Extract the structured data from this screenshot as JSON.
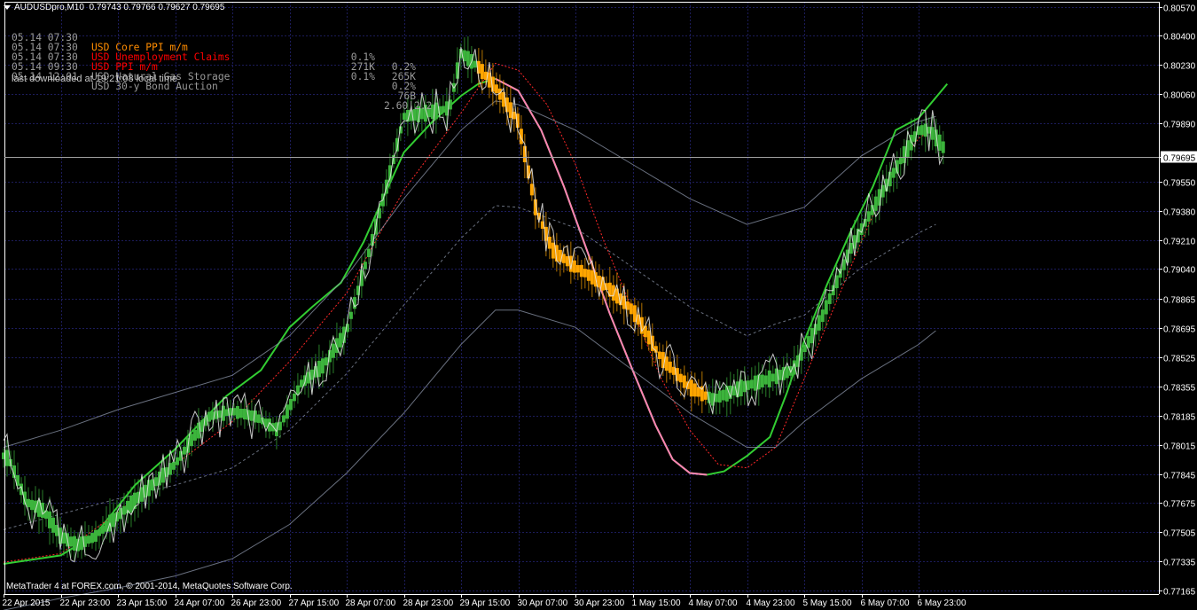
{
  "header": {
    "symbol": "AUDUSDpro,M10",
    "ohlc": "0.79743 0.79766 0.79627 0.79695"
  },
  "news": [
    {
      "time": "05.14 07:30",
      "currency": "USD",
      "event": "Core PPI m/m",
      "actual": "0.1%",
      "forecast": "0.2%",
      "color": "#ff8c00"
    },
    {
      "time": "05.14 07:30",
      "currency": "USD",
      "event": "Unemployment Claims",
      "actual": "271K",
      "forecast": "265K",
      "color": "#ff0000"
    },
    {
      "time": "05.14 07:30",
      "currency": "USD",
      "event": "PPI m/m",
      "actual": "0.1%",
      "forecast": "0.2%",
      "color": "#ff0000"
    },
    {
      "time": "05.14 09:30",
      "currency": "USD",
      "event": "Natural Gas Storage",
      "actual": "",
      "forecast": "76B",
      "color": "#9a9a9a"
    },
    {
      "time": "05.14 12:01",
      "currency": "USD",
      "event": "30-y Bond Auction",
      "actual": "",
      "forecast": "2.60|2.2",
      "color": "#9a9a9a"
    }
  ],
  "download_note": "last downloaded at 19:21:08 local time",
  "copyright": "MetaTrader 4 at FOREX.com, © 2001-2014, MetaQuotes Software Corp.",
  "colors": {
    "background": "#000000",
    "grid": "#1c1c5a",
    "axis": "#ffffff",
    "bull": "#3cb43c",
    "bear": "#ffa500",
    "close_line": "#e6e6e6",
    "ma_green": "#32cd32",
    "ma_pink": "#ff82b4",
    "ma_red_dotted": "#ff2828",
    "band_gray": "#8c96aa",
    "bid_line": "#a0a0a0"
  },
  "chart_data": {
    "type": "line",
    "title": "AUDUSDpro,M10",
    "ylim": [
      0.77165,
      0.80578
    ],
    "current_price": 0.79695,
    "y_ticks": [
      "0.80570",
      "0.80400",
      "0.80230",
      "0.80060",
      "0.79890",
      "0.79695",
      "0.79550",
      "0.79380",
      "0.79210",
      "0.79040",
      "0.78865",
      "0.78695",
      "0.78525",
      "0.78355",
      "0.78185",
      "0.78015",
      "0.77845",
      "0.77675",
      "0.77505",
      "0.77335",
      "0.77165"
    ],
    "x_ticks": [
      "22 Apr 2015",
      "22 Apr 23:00",
      "23 Apr 15:00",
      "24 Apr 07:00",
      "26 Apr 23:00",
      "27 Apr 15:00",
      "28 Apr 07:00",
      "28 Apr 23:00",
      "29 Apr 15:00",
      "30 Apr 07:00",
      "30 Apr 23:00",
      "1 May 15:00",
      "4 May 07:00",
      "4 May 23:00",
      "5 May 15:00",
      "6 May 07:00",
      "6 May 23:00"
    ],
    "x_positions": [
      0,
      1,
      2,
      3,
      4,
      5,
      6,
      7,
      8,
      9,
      10,
      11,
      12,
      13,
      14,
      15,
      16
    ],
    "price_path": [
      [
        0.0,
        0.7795
      ],
      [
        0.1,
        0.7793
      ],
      [
        0.4,
        0.7768
      ],
      [
        0.7,
        0.7763
      ],
      [
        1.0,
        0.7748
      ],
      [
        1.3,
        0.7743
      ],
      [
        1.6,
        0.7748
      ],
      [
        2.0,
        0.776
      ],
      [
        2.5,
        0.7775
      ],
      [
        3.0,
        0.779
      ],
      [
        3.3,
        0.7805
      ],
      [
        3.6,
        0.7818
      ],
      [
        4.0,
        0.7821
      ],
      [
        4.4,
        0.7818
      ],
      [
        4.7,
        0.7812
      ],
      [
        4.8,
        0.781
      ],
      [
        5.2,
        0.7837
      ],
      [
        5.6,
        0.7848
      ],
      [
        6.0,
        0.7868
      ],
      [
        6.4,
        0.7915
      ],
      [
        6.8,
        0.7965
      ],
      [
        7.0,
        0.7993
      ],
      [
        7.4,
        0.7995
      ],
      [
        7.8,
        0.7998
      ],
      [
        8.0,
        0.803
      ],
      [
        8.3,
        0.8022
      ],
      [
        8.6,
        0.801
      ],
      [
        9.0,
        0.799
      ],
      [
        9.3,
        0.794
      ],
      [
        9.6,
        0.7915
      ],
      [
        10.0,
        0.7905
      ],
      [
        10.5,
        0.7895
      ],
      [
        11.0,
        0.788
      ],
      [
        11.5,
        0.7852
      ],
      [
        12.0,
        0.7835
      ],
      [
        12.4,
        0.7828
      ],
      [
        13.0,
        0.7836
      ],
      [
        13.4,
        0.784
      ],
      [
        13.8,
        0.7845
      ],
      [
        14.3,
        0.7875
      ],
      [
        14.8,
        0.7915
      ],
      [
        15.3,
        0.7945
      ],
      [
        15.7,
        0.7968
      ],
      [
        16.0,
        0.7985
      ],
      [
        16.2,
        0.7985
      ],
      [
        16.5,
        0.7972
      ],
      [
        16.5,
        0.79695
      ]
    ],
    "bear_segment": [
      8.3,
      12.3
    ],
    "series": [
      {
        "name": "",
        "color": "#32cd32",
        "style": "solid",
        "values": [
          [
            0.0,
            0.7732
          ],
          [
            1.0,
            0.7737
          ],
          [
            1.6,
            0.7749
          ],
          [
            2.3,
            0.7778
          ],
          [
            3.0,
            0.7799
          ],
          [
            3.9,
            0.783
          ],
          [
            4.5,
            0.7845
          ],
          [
            5.0,
            0.787
          ],
          [
            5.4,
            0.7882
          ],
          [
            5.9,
            0.7896
          ],
          [
            6.3,
            0.792
          ],
          [
            6.7,
            0.795
          ],
          [
            7.0,
            0.7972
          ],
          [
            7.5,
            0.799
          ],
          [
            8.0,
            0.8005
          ],
          [
            8.3,
            0.8012
          ],
          [
            8.6,
            0.8015
          ],
          [
            9.0,
            0.8008
          ],
          [
            9.4,
            0.7985
          ],
          [
            9.8,
            0.7952
          ],
          [
            10.2,
            0.7915
          ],
          [
            10.6,
            0.7878
          ],
          [
            11.0,
            0.7845
          ],
          [
            11.4,
            0.7813
          ],
          [
            11.7,
            0.7793
          ],
          [
            12.0,
            0.7785
          ],
          [
            12.3,
            0.7784
          ],
          [
            12.6,
            0.7786
          ],
          [
            13.0,
            0.7795
          ],
          [
            13.4,
            0.7806
          ],
          [
            13.7,
            0.7832
          ],
          [
            14.0,
            0.7862
          ],
          [
            14.4,
            0.7895
          ],
          [
            14.8,
            0.7925
          ],
          [
            15.2,
            0.7952
          ],
          [
            15.6,
            0.7985
          ],
          [
            16.0,
            0.7992
          ],
          [
            16.2,
            0.8
          ],
          [
            16.5,
            0.8012
          ]
        ]
      },
      {
        "name": "",
        "color": "#ff82b4",
        "style": "solid",
        "values": [
          [
            8.6,
            0.8015
          ],
          [
            9.0,
            0.8008
          ],
          [
            9.4,
            0.7985
          ],
          [
            9.8,
            0.7952
          ],
          [
            10.2,
            0.7915
          ],
          [
            10.6,
            0.7878
          ],
          [
            11.0,
            0.7845
          ],
          [
            11.4,
            0.7813
          ],
          [
            11.7,
            0.7793
          ],
          [
            12.0,
            0.7785
          ],
          [
            12.3,
            0.7784
          ]
        ]
      },
      {
        "name": "",
        "color": "#ff2828",
        "style": "dotted",
        "values": [
          [
            0.0,
            0.7733
          ],
          [
            1.0,
            0.7738
          ],
          [
            2.0,
            0.7762
          ],
          [
            3.0,
            0.779
          ],
          [
            4.0,
            0.7815
          ],
          [
            5.0,
            0.785
          ],
          [
            6.0,
            0.789
          ],
          [
            7.0,
            0.795
          ],
          [
            8.0,
            0.7995
          ],
          [
            8.6,
            0.8024
          ],
          [
            9.0,
            0.802
          ],
          [
            9.5,
            0.8
          ],
          [
            10.0,
            0.7965
          ],
          [
            10.5,
            0.792
          ],
          [
            11.0,
            0.788
          ],
          [
            11.5,
            0.784
          ],
          [
            12.0,
            0.781
          ],
          [
            12.5,
            0.779
          ],
          [
            13.0,
            0.7788
          ],
          [
            13.5,
            0.78
          ],
          [
            14.0,
            0.784
          ],
          [
            14.5,
            0.788
          ],
          [
            15.0,
            0.792
          ],
          [
            15.5,
            0.7958
          ],
          [
            16.0,
            0.798
          ],
          [
            16.2,
            0.7985
          ]
        ]
      },
      {
        "name": "",
        "color": "#8c96aa",
        "style": "solid",
        "values": [
          [
            0.0,
            0.78
          ],
          [
            1.0,
            0.781
          ],
          [
            2.0,
            0.7822
          ],
          [
            3.0,
            0.7832
          ],
          [
            4.0,
            0.7842
          ],
          [
            5.0,
            0.7865
          ],
          [
            6.0,
            0.79
          ],
          [
            7.0,
            0.7945
          ],
          [
            8.0,
            0.7985
          ],
          [
            8.6,
            0.8002
          ],
          [
            9.0,
            0.8
          ],
          [
            10.0,
            0.7985
          ],
          [
            11.0,
            0.7965
          ],
          [
            12.0,
            0.7945
          ],
          [
            13.0,
            0.793
          ],
          [
            14.0,
            0.794
          ],
          [
            15.0,
            0.797
          ],
          [
            16.0,
            0.799
          ],
          [
            16.3,
            0.7993
          ]
        ]
      },
      {
        "name": "",
        "color": "#8c96aa",
        "style": "solid",
        "values": [
          [
            0.0,
            0.7705
          ],
          [
            1.0,
            0.7712
          ],
          [
            2.0,
            0.7718
          ],
          [
            3.0,
            0.7725
          ],
          [
            4.0,
            0.7735
          ],
          [
            5.0,
            0.7755
          ],
          [
            6.0,
            0.7785
          ],
          [
            7.0,
            0.782
          ],
          [
            8.0,
            0.786
          ],
          [
            8.6,
            0.788
          ],
          [
            9.0,
            0.788
          ],
          [
            10.0,
            0.787
          ],
          [
            11.0,
            0.7845
          ],
          [
            12.0,
            0.782
          ],
          [
            13.0,
            0.78
          ],
          [
            13.5,
            0.78
          ],
          [
            14.0,
            0.7815
          ],
          [
            15.0,
            0.784
          ],
          [
            16.0,
            0.786
          ],
          [
            16.3,
            0.7868
          ]
        ]
      },
      {
        "name": "",
        "color": "#8c96aa",
        "style": "dashed",
        "values": [
          [
            0.0,
            0.7752
          ],
          [
            1.0,
            0.7761
          ],
          [
            2.0,
            0.777
          ],
          [
            3.0,
            0.7778
          ],
          [
            4.0,
            0.7788
          ],
          [
            5.0,
            0.781
          ],
          [
            6.0,
            0.7843
          ],
          [
            7.0,
            0.7883
          ],
          [
            8.0,
            0.7922
          ],
          [
            8.6,
            0.7941
          ],
          [
            9.0,
            0.794
          ],
          [
            10.0,
            0.7928
          ],
          [
            11.0,
            0.7905
          ],
          [
            12.0,
            0.7882
          ],
          [
            13.0,
            0.7865
          ],
          [
            13.5,
            0.7872
          ],
          [
            14.0,
            0.7877
          ],
          [
            15.0,
            0.7905
          ],
          [
            16.0,
            0.7925
          ],
          [
            16.3,
            0.793
          ]
        ]
      }
    ]
  }
}
